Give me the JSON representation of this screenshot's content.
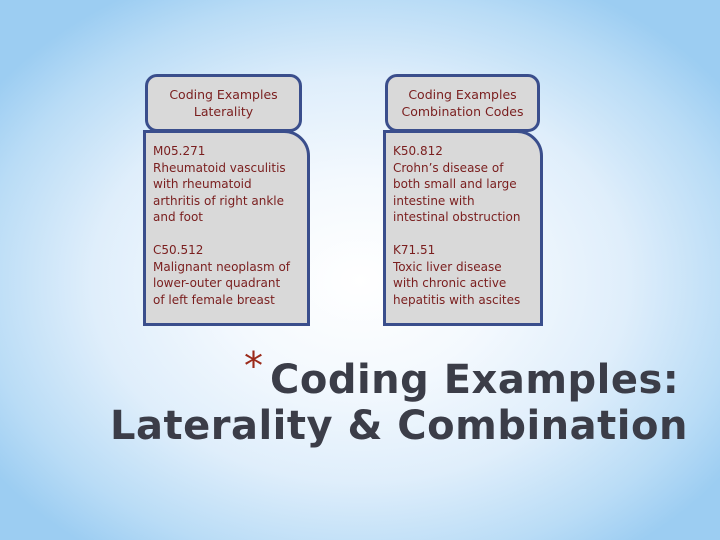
{
  "columns": [
    {
      "header": [
        "Coding Examples",
        "Laterality"
      ],
      "entries": [
        {
          "code": "M05.271",
          "lines": [
            "Rheumatoid vasculitis",
            "with rheumatoid",
            "arthritis of right ankle",
            "and foot"
          ]
        },
        {
          "code": "C50.512",
          "lines": [
            "Malignant neoplasm of",
            "lower-outer quadrant",
            "of left female breast"
          ]
        }
      ]
    },
    {
      "header": [
        "Coding Examples",
        "Combination Codes"
      ],
      "entries": [
        {
          "code": "K50.812",
          "lines": [
            "Crohn’s disease of",
            "both small and large",
            "intestine with",
            "intestinal obstruction"
          ]
        },
        {
          "code": "K71.51",
          "lines": [
            "Toxic liver disease",
            "with chronic active",
            "hepatitis with ascites"
          ]
        }
      ]
    }
  ],
  "title": {
    "bullet": "*",
    "line1": "Coding Examples:",
    "line2": "Laterality & Combination"
  },
  "colors": {
    "box_fill": "#d9d9d9",
    "box_border": "#3a4e8c",
    "box_text": "#7a1e1e",
    "title_text": "#3b3d48",
    "bullet": "#9b2a1a"
  }
}
